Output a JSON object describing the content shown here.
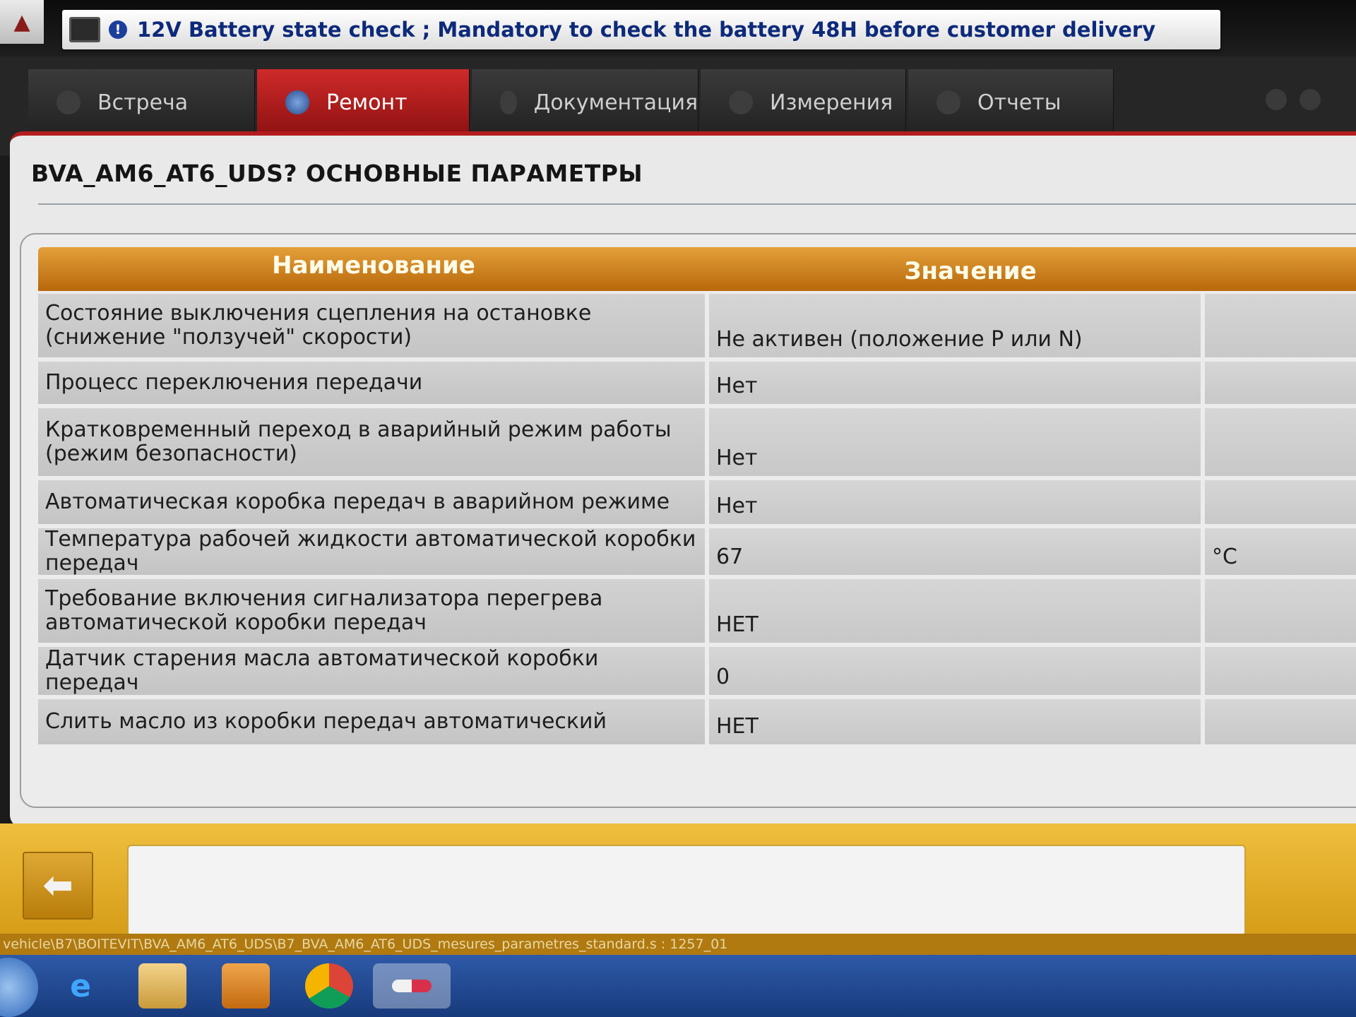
{
  "alert": {
    "text": "12V Battery state check ; Mandatory to check the battery 48H before customer delivery"
  },
  "tabs": [
    {
      "label": "Встреча",
      "active": false
    },
    {
      "label": "Ремонт",
      "active": true
    },
    {
      "label": "Документация",
      "active": false
    },
    {
      "label": "Измерения",
      "active": false
    },
    {
      "label": "Отчеты",
      "active": false
    }
  ],
  "page": {
    "title": "BVA_AM6_AT6_UDS?  ОСНОВНЫЕ ПАРАМЕТРЫ"
  },
  "table": {
    "headers": {
      "name": "Наименование",
      "value": "Значение"
    },
    "rows": [
      {
        "name": "Состояние выключения сцепления на остановке (снижение \"ползучей\" скорости)",
        "value": "Не активен (положение Р или N)",
        "unit": ""
      },
      {
        "name": "Процесс переключения передачи",
        "value": "Нет",
        "unit": ""
      },
      {
        "name": "Кратковременный переход в аварийный режим работы (режим безопасности)",
        "value": "Нет",
        "unit": ""
      },
      {
        "name": "Автоматическая коробка передач в аварийном режиме",
        "value": "Нет",
        "unit": ""
      },
      {
        "name": "Температура рабочей жидкости автоматической коробки передач",
        "value": "67",
        "unit": "°C"
      },
      {
        "name": "Требование включения сигнализатора перегрева автоматической коробки передач",
        "value": "НЕТ",
        "unit": ""
      },
      {
        "name": "Датчик старения масла автоматической коробки передач",
        "value": "0",
        "unit": ""
      },
      {
        "name": "Слить масло из коробки передач автоматический",
        "value": "НЕТ",
        "unit": ""
      }
    ]
  },
  "footer": {
    "back_icon": "back-arrow-icon",
    "path": "vehicle\\B7\\BOITEVIT\\BVA_AM6_AT6_UDS\\B7_BVA_AM6_AT6_UDS_mesures_parametres_standard.s : 1257_01"
  },
  "taskbar": {
    "icons": [
      "start-icon",
      "internet-explorer-icon",
      "folder-icon",
      "media-player-icon",
      "chrome-icon",
      "diagnostic-app-icon"
    ]
  },
  "colors": {
    "accent_red": "#b31d1d",
    "header_orange": "#c97a14",
    "alert_text": "#0d2a7a"
  }
}
